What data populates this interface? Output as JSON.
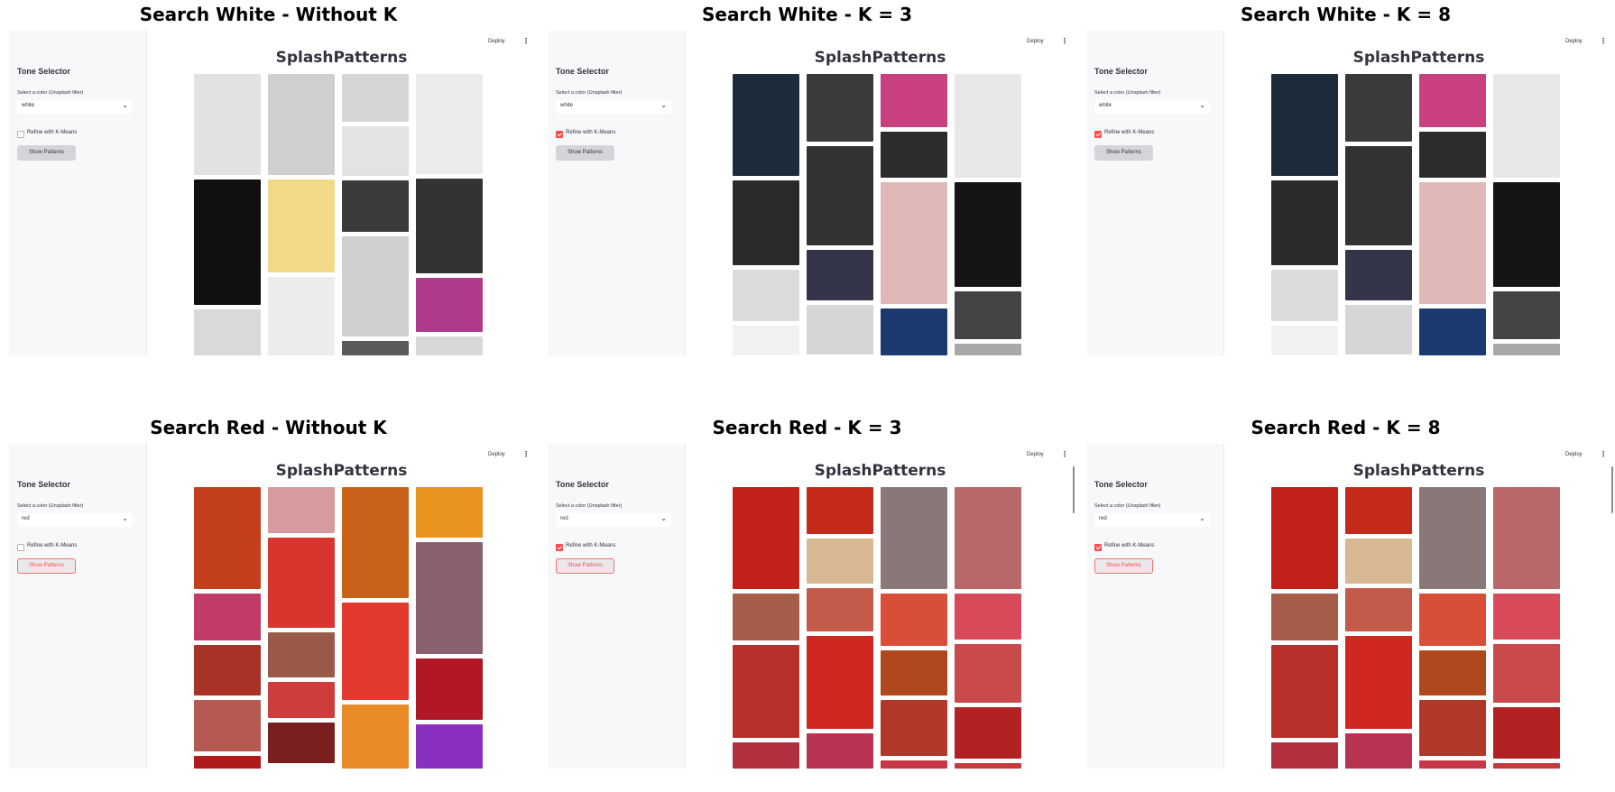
{
  "panels": [
    {
      "title": "Search White - Without K",
      "color_value": "white",
      "refine_checked": false,
      "button_style": "gray",
      "scrollbar": false,
      "tiles": [
        [
          [
            "#e2e2e2",
            112
          ],
          [
            "#101010",
            139
          ],
          [
            "#d9d9d9",
            52
          ]
        ],
        [
          [
            "#cfcfcf",
            112
          ],
          [
            "#f2d98a",
            103
          ],
          [
            "#ececec",
            88
          ]
        ],
        [
          [
            "#d6d6d6",
            53
          ],
          [
            "#e3e3e3",
            55
          ],
          [
            "#3a3a3a",
            57
          ],
          [
            "#d0d0d0",
            111
          ],
          [
            "#5a5a5a",
            30
          ]
        ],
        [
          [
            "#ebebeb",
            111
          ],
          [
            "#333333",
            105
          ],
          [
            "#b03a8e",
            60
          ],
          [
            "#d8d8d8",
            30
          ]
        ]
      ]
    },
    {
      "title": "Search White - K = 3",
      "color_value": "white",
      "refine_checked": true,
      "button_style": "gray",
      "scrollbar": false,
      "tiles": [
        [
          [
            "#1d2c3a",
            113
          ],
          [
            "#2a2a2a",
            94
          ],
          [
            "#dcdcdc",
            57
          ],
          [
            "#f2f2f2",
            48
          ]
        ],
        [
          [
            "#3a3a3a",
            75
          ],
          [
            "#323232",
            110
          ],
          [
            "#34344a",
            56
          ],
          [
            "#d6d6d6",
            55
          ],
          [
            "#9ed8e0",
            16
          ]
        ],
        [
          [
            "#c84080",
            59
          ],
          [
            "#2c2c2c",
            51
          ],
          [
            "#e0b8b8",
            135
          ],
          [
            "#1a3a70",
            56
          ]
        ],
        [
          [
            "#e8e8e8",
            115
          ],
          [
            "#151515",
            116
          ],
          [
            "#444444",
            53
          ],
          [
            "#a8a8a8",
            28
          ]
        ]
      ]
    },
    {
      "title": "Search White - K = 8",
      "color_value": "white",
      "refine_checked": true,
      "button_style": "gray",
      "scrollbar": false,
      "tiles": [
        [
          [
            "#1d2c3a",
            113
          ],
          [
            "#2a2a2a",
            94
          ],
          [
            "#dcdcdc",
            57
          ],
          [
            "#f2f2f2",
            48
          ]
        ],
        [
          [
            "#3a3a3a",
            75
          ],
          [
            "#323232",
            110
          ],
          [
            "#34344a",
            56
          ],
          [
            "#d6d6d6",
            55
          ],
          [
            "#9ed8e0",
            16
          ]
        ],
        [
          [
            "#c84080",
            59
          ],
          [
            "#2c2c2c",
            51
          ],
          [
            "#e0b8b8",
            135
          ],
          [
            "#1a3a70",
            56
          ]
        ],
        [
          [
            "#e8e8e8",
            115
          ],
          [
            "#151515",
            116
          ],
          [
            "#444444",
            53
          ],
          [
            "#a8a8a8",
            28
          ]
        ]
      ]
    },
    {
      "title": "Search Red - Without K",
      "color_value": "red",
      "refine_checked": false,
      "button_style": "red",
      "scrollbar": false,
      "tiles": [
        [
          [
            "#c4401c",
            113
          ],
          [
            "#c23a66",
            52
          ],
          [
            "#a83226",
            56
          ],
          [
            "#b55a50",
            57
          ],
          [
            "#b01a1a",
            20
          ]
        ],
        [
          [
            "#d79a9e",
            51
          ],
          [
            "#d8352e",
            100
          ],
          [
            "#9a5a4a",
            50
          ],
          [
            "#cf3c3c",
            40
          ],
          [
            "#7a1f1f",
            45
          ]
        ],
        [
          [
            "#c8621a",
            123
          ],
          [
            "#e23a2e",
            108
          ],
          [
            "#e88a28",
            84
          ]
        ],
        [
          [
            "#e9941e",
            56
          ],
          [
            "#8a6070",
            124
          ],
          [
            "#b01624",
            68
          ],
          [
            "#8a30c0",
            57
          ],
          [
            "#d21e1e",
            20
          ]
        ]
      ]
    },
    {
      "title": "Search Red - K = 3",
      "color_value": "red",
      "refine_checked": true,
      "button_style": "red",
      "scrollbar": true,
      "tiles": [
        [
          [
            "#c2201a",
            113
          ],
          [
            "#a85c4a",
            52
          ],
          [
            "#b8302a",
            103
          ],
          [
            "#b03040",
            40
          ]
        ],
        [
          [
            "#c42a1a",
            52
          ],
          [
            "#d8b892",
            50
          ],
          [
            "#c45a4a",
            48
          ],
          [
            "#d02820",
            103
          ],
          [
            "#b83252",
            60
          ]
        ],
        [
          [
            "#8a7878",
            113
          ],
          [
            "#d84e36",
            58
          ],
          [
            "#b0481e",
            50
          ],
          [
            "#b0382a",
            62
          ],
          [
            "#c83848",
            20
          ]
        ],
        [
          [
            "#b86868",
            113
          ],
          [
            "#d84a5a",
            51
          ],
          [
            "#c84a4a",
            65
          ],
          [
            "#b22222",
            57
          ],
          [
            "#c83a3a",
            26
          ]
        ]
      ]
    },
    {
      "title": "Search Red - K = 8",
      "color_value": "red",
      "refine_checked": true,
      "button_style": "red",
      "scrollbar": true,
      "tiles": [
        [
          [
            "#c2201a",
            113
          ],
          [
            "#a85c4a",
            52
          ],
          [
            "#b8302a",
            103
          ],
          [
            "#b03040",
            40
          ]
        ],
        [
          [
            "#c42a1a",
            52
          ],
          [
            "#d8b892",
            50
          ],
          [
            "#c45a4a",
            48
          ],
          [
            "#d02820",
            103
          ],
          [
            "#b83252",
            60
          ]
        ],
        [
          [
            "#8a7878",
            113
          ],
          [
            "#d84e36",
            58
          ],
          [
            "#b0481e",
            50
          ],
          [
            "#b0382a",
            62
          ],
          [
            "#c83848",
            20
          ]
        ],
        [
          [
            "#b86868",
            113
          ],
          [
            "#d84a5a",
            51
          ],
          [
            "#c84a4a",
            65
          ],
          [
            "#b22222",
            57
          ],
          [
            "#c83a3a",
            26
          ]
        ]
      ]
    }
  ],
  "ui": {
    "sidebar_title": "Tone Selector",
    "select_label": "Select a color (Unsplash filter)",
    "refine_label": "Refine with K-Means",
    "button_label": "Show Patterns",
    "deploy_label": "Deploy",
    "app_title": "SplashPatterns"
  }
}
